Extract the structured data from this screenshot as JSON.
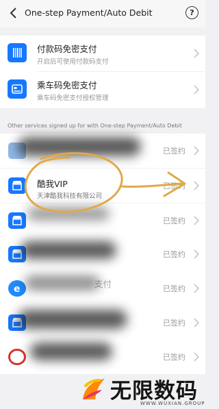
{
  "header": {
    "title": "One-step Payment/Auto Debit",
    "help_symbol": "?"
  },
  "quick": [
    {
      "title": "付款码免密支付",
      "subtitle": "开启后可使用付款码支付",
      "icon": "barcode-icon"
    },
    {
      "title": "乘车码免密支付",
      "subtitle": "乘车码免密支付授权管理",
      "icon": "bus-card-icon"
    }
  ],
  "section_label": "Other services signed up for with One-step Payment/Auto Debit",
  "services": [
    {
      "name": "",
      "company": "",
      "status": "已签约",
      "icon": "redacted-service-icon"
    },
    {
      "name": "酷我VIP",
      "company": "天津酷我科技有限公司",
      "status": "已签约",
      "icon": "store-icon"
    },
    {
      "name": "",
      "company": "",
      "status": "已签约",
      "icon": "store-icon"
    },
    {
      "name": "",
      "company": "",
      "status": "已签约",
      "icon": "store-icon"
    },
    {
      "name": "支付",
      "company": "",
      "status": "已签约",
      "icon": "e-app-icon"
    },
    {
      "name": "",
      "company": "",
      "status": "已签约",
      "icon": "store-icon"
    },
    {
      "name": "",
      "company": "",
      "status": "已签约",
      "icon": "red-app-icon"
    }
  ],
  "watermark": {
    "brand": "无限数码",
    "url": "WWW.WUXIAN.GROUP"
  },
  "colors": {
    "accent": "#1677ff",
    "highlight_scribble": "#e0a948"
  }
}
